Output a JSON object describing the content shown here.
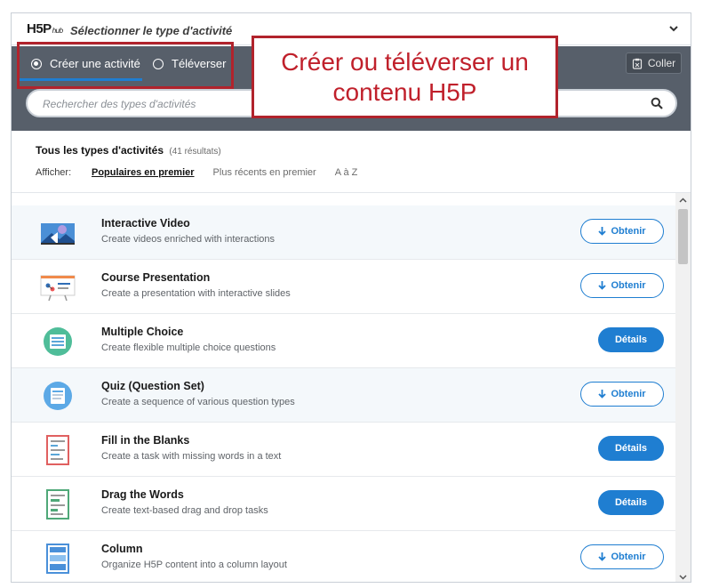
{
  "header": {
    "logo_text": "H5P",
    "logo_sub": "hub",
    "title": "Sélectionner le type d'activité"
  },
  "tabs": [
    {
      "label": "Créer une activité",
      "active": true
    },
    {
      "label": "Téléverser",
      "active": false
    }
  ],
  "paste_label": "Coller",
  "search": {
    "placeholder": "Rechercher des types d'activités"
  },
  "filter": {
    "title": "Tous les types d'activités",
    "count": "(41 résultats)",
    "show_label": "Afficher:",
    "options": [
      "Populaires en premier",
      "Plus récents en premier",
      "A à Z"
    ]
  },
  "items": [
    {
      "name": "Interactive Video",
      "desc": "Create videos enriched with interactions",
      "action": "Obtenir",
      "icon": "interactive-video-icon"
    },
    {
      "name": "Course Presentation",
      "desc": "Create a presentation with interactive slides",
      "action": "Obtenir",
      "icon": "course-presentation-icon"
    },
    {
      "name": "Multiple Choice",
      "desc": "Create flexible multiple choice questions",
      "action": "Détails",
      "icon": "multiple-choice-icon"
    },
    {
      "name": "Quiz (Question Set)",
      "desc": "Create a sequence of various question types",
      "action": "Obtenir",
      "icon": "quiz-icon"
    },
    {
      "name": "Fill in the Blanks",
      "desc": "Create a task with missing words in a text",
      "action": "Détails",
      "icon": "fill-blanks-icon"
    },
    {
      "name": "Drag the Words",
      "desc": "Create text-based drag and drop tasks",
      "action": "Détails",
      "icon": "drag-words-icon"
    },
    {
      "name": "Column",
      "desc": "Organize H5P content into a column layout",
      "action": "Obtenir",
      "icon": "column-icon"
    }
  ],
  "annotation": {
    "line1": "Créer ou téléverser un",
    "line2": "contenu H5P"
  },
  "colors": {
    "accent": "#1f7ed1",
    "annotation": "#c0202b",
    "toolbar": "#575f6a"
  }
}
